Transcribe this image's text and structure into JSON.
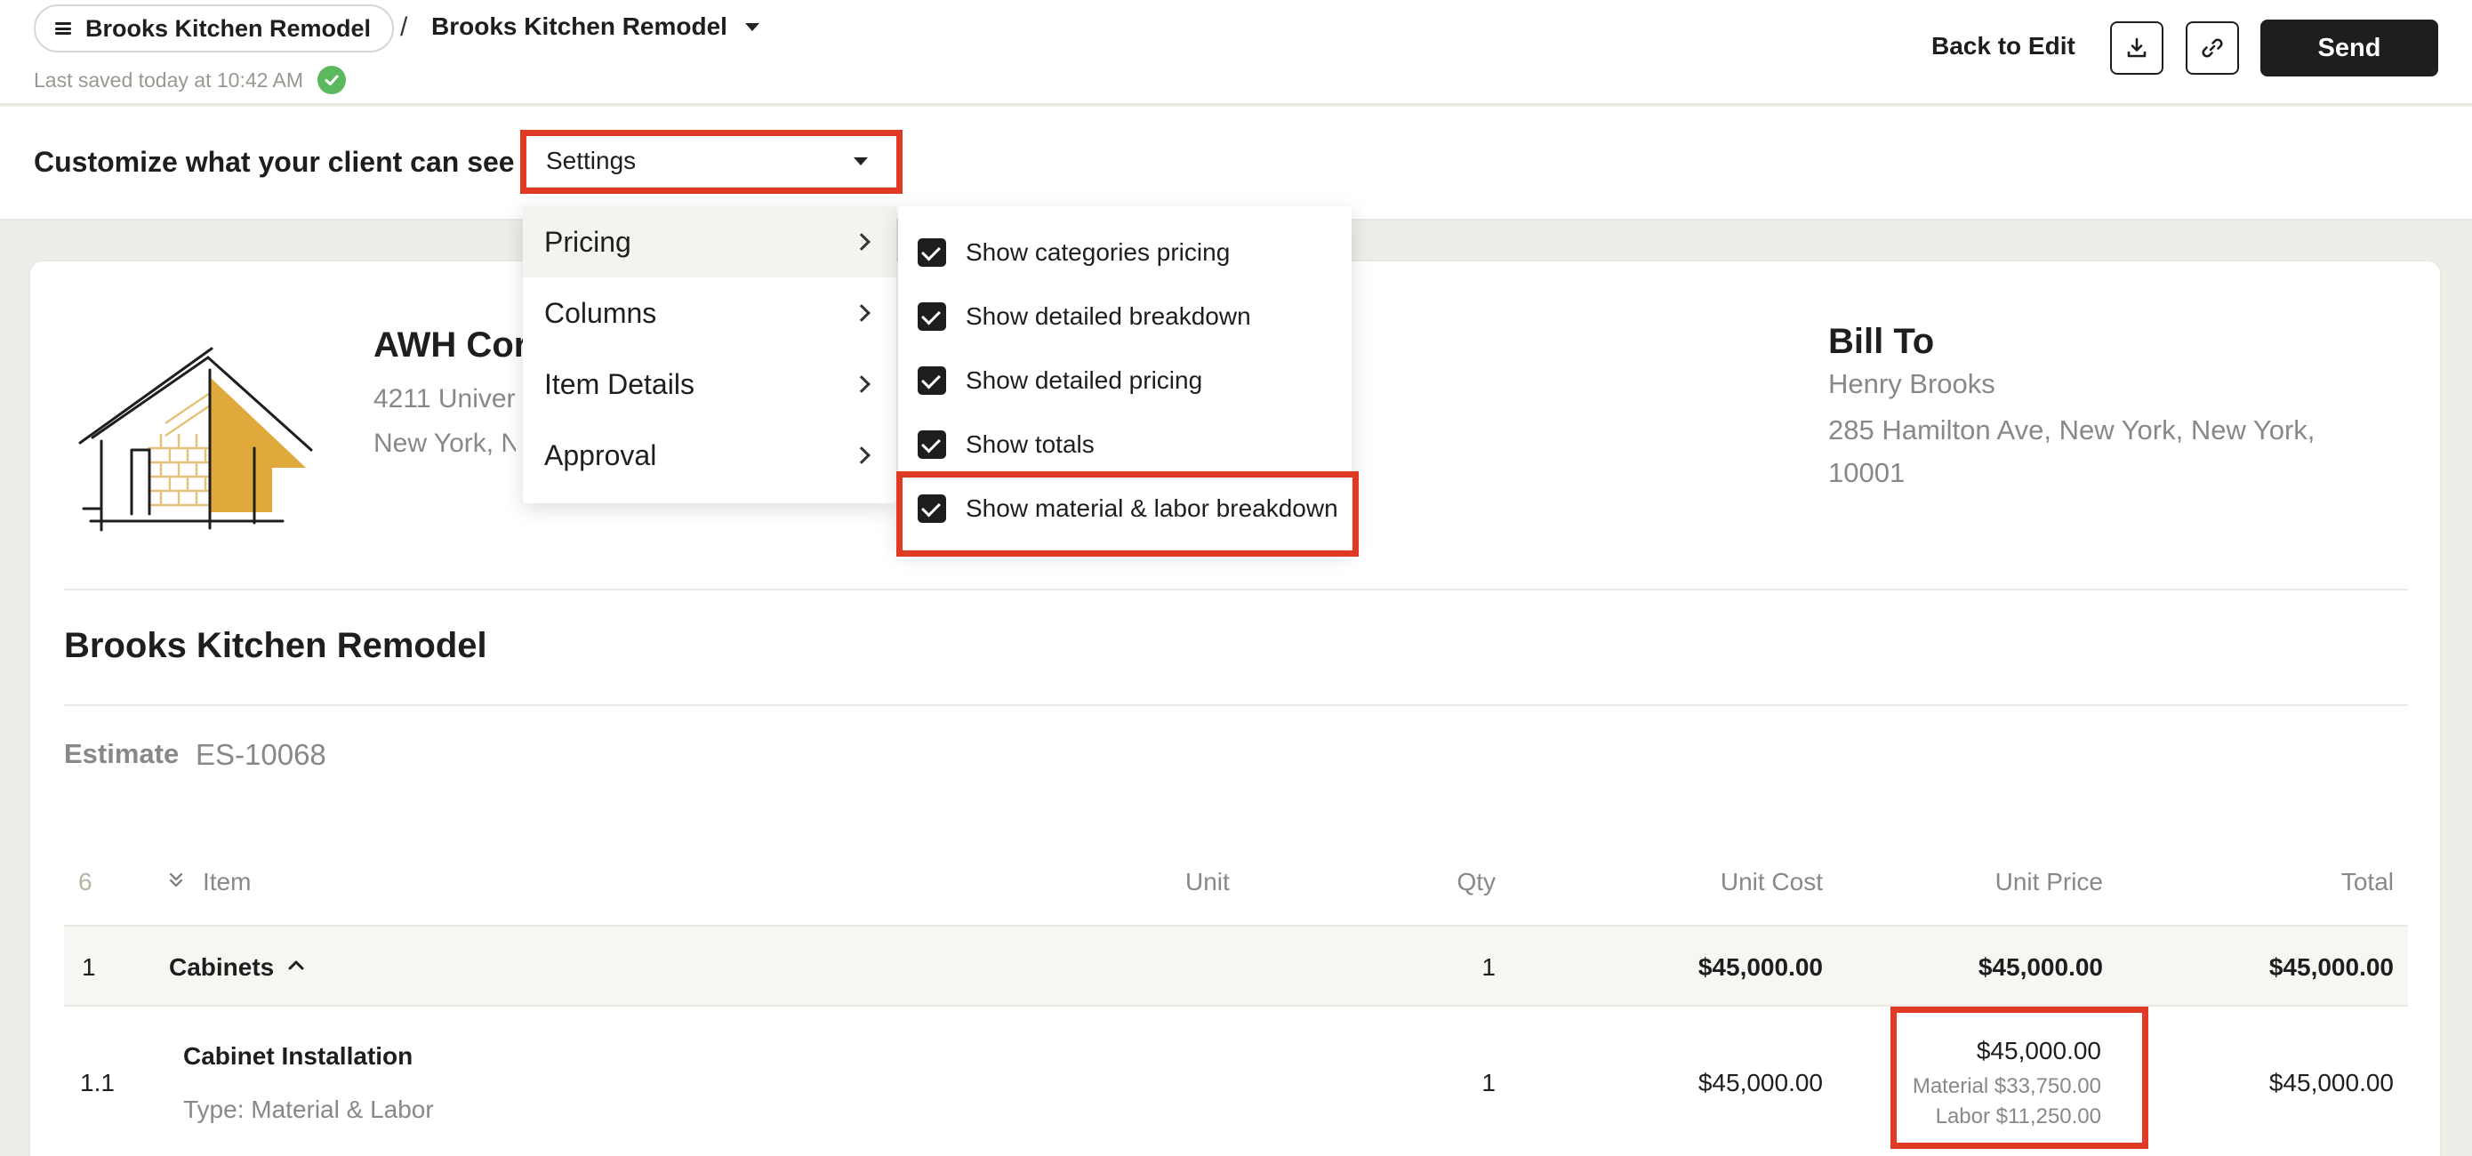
{
  "header": {
    "breadcrumb_root": "Brooks Kitchen Remodel",
    "breadcrumb_separator": "/",
    "breadcrumb_current": "Brooks Kitchen Remodel",
    "saved_status": "Last saved today at 10:42 AM",
    "back_to_edit": "Back to Edit",
    "send": "Send"
  },
  "customize": {
    "label": "Customize what your client can see",
    "select_value": "Settings"
  },
  "settings_menu": {
    "items": [
      {
        "label": "Pricing"
      },
      {
        "label": "Columns"
      },
      {
        "label": "Item Details"
      },
      {
        "label": "Approval"
      }
    ]
  },
  "pricing_submenu": {
    "items": [
      {
        "label": "Show categories pricing",
        "checked": true
      },
      {
        "label": "Show detailed breakdown",
        "checked": true
      },
      {
        "label": "Show detailed pricing",
        "checked": true
      },
      {
        "label": "Show totals",
        "checked": true
      },
      {
        "label": "Show material & labor breakdown",
        "checked": true
      }
    ]
  },
  "company": {
    "name": "AWH Cor",
    "address_line1": "4211 Univers",
    "address_line2": "New York, N"
  },
  "bill_to": {
    "title": "Bill To",
    "name": "Henry Brooks",
    "address": "285 Hamilton Ave, New York, New York, 10001"
  },
  "project": {
    "title": "Brooks Kitchen Remodel",
    "estimate_label": "Estimate",
    "estimate_number": "ES-10068"
  },
  "table": {
    "count": "6",
    "headers": {
      "item": "Item",
      "unit": "Unit",
      "qty": "Qty",
      "unit_cost": "Unit Cost",
      "unit_price": "Unit Price",
      "total": "Total"
    },
    "category_row": {
      "num": "1",
      "name": "Cabinets",
      "qty": "1",
      "unit_cost": "$45,000.00",
      "unit_price": "$45,000.00",
      "total": "$45,000.00"
    },
    "item_row": {
      "num": "1.1",
      "name": "Cabinet Installation",
      "type": "Type: Material & Labor",
      "qty": "1",
      "unit_cost": "$45,000.00",
      "unit_price": "$45,000.00",
      "material": "Material $33,750.00",
      "labor": "Labor $11,250.00",
      "total": "$45,000.00"
    }
  },
  "colors": {
    "highlight": "#e03a24",
    "primary": "#1e1e1e",
    "success": "#5cb85c",
    "logo_accent": "#e0a93b"
  }
}
